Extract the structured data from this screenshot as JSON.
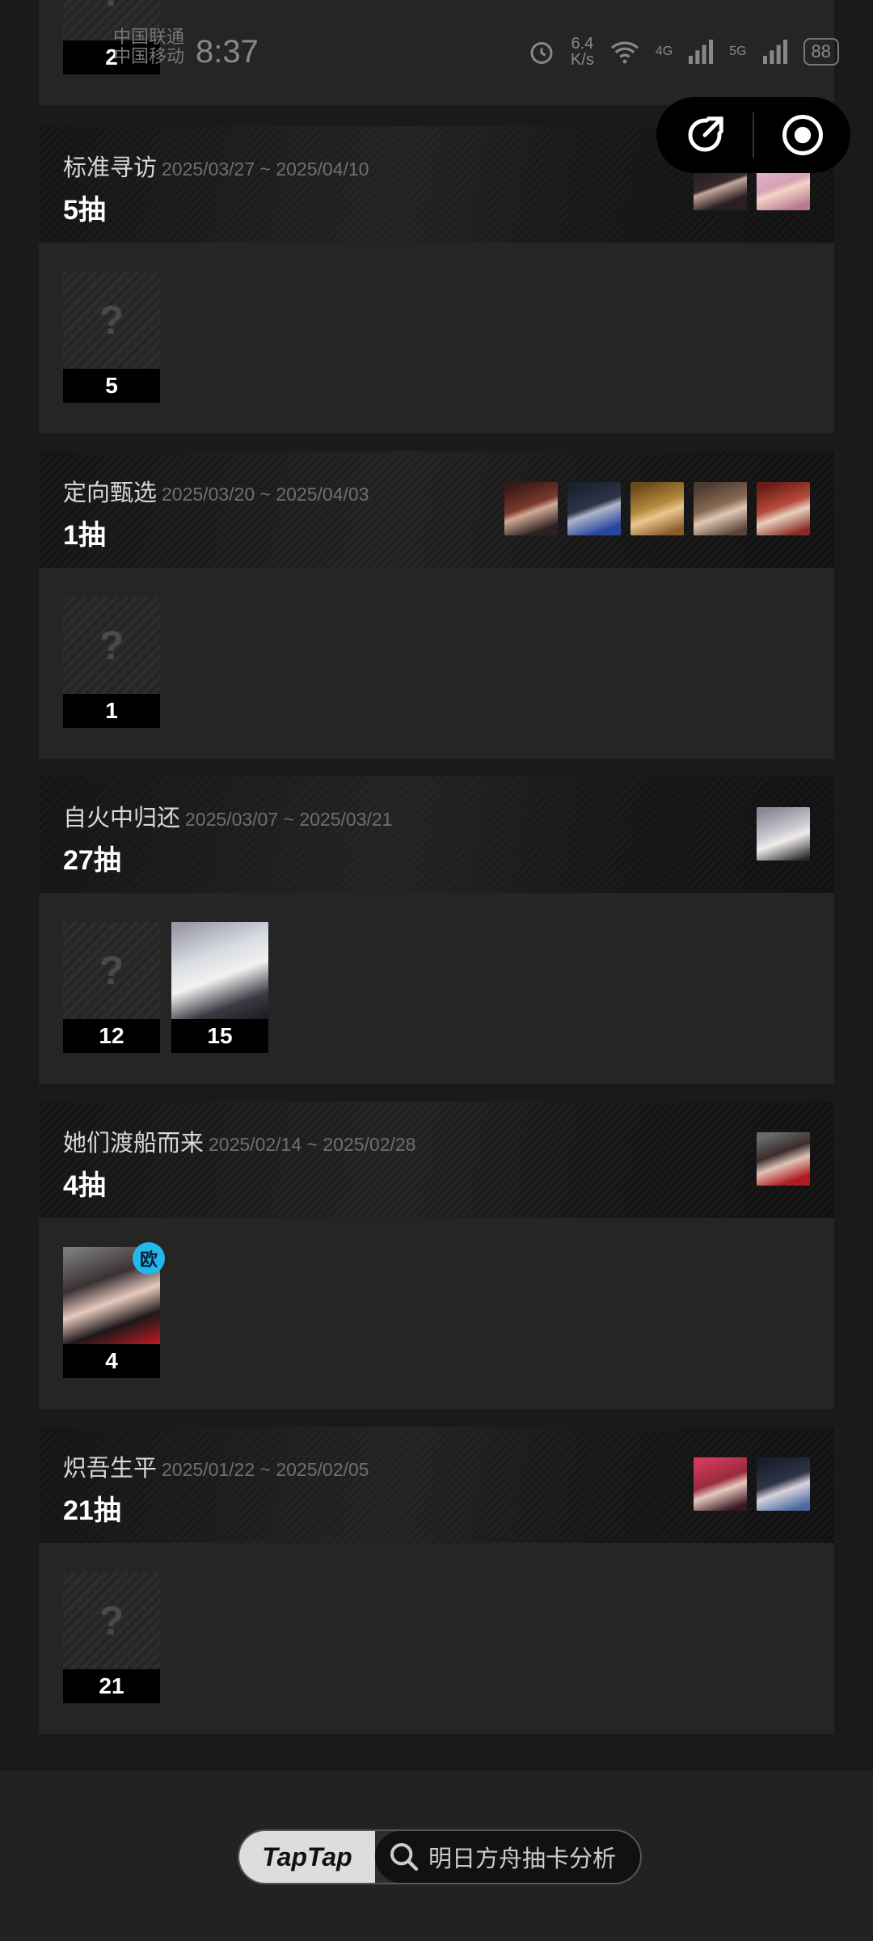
{
  "status_bar": {
    "carrier_1": "中国联通",
    "carrier_2": "中国移动",
    "time": "8:37",
    "net_speed_value": "6.4",
    "net_speed_unit": "K/s",
    "net_4g": "4G",
    "net_5g": "5G",
    "battery": "88"
  },
  "capsule": {
    "share_icon": "share-arrow-icon",
    "record_icon": "record-target-icon"
  },
  "top_card": {
    "count": "2"
  },
  "pools": [
    {
      "name": "标准寻访",
      "dates": "2025/03/27 ~ 2025/04/10",
      "pulls": "5抽",
      "avatars": [
        {
          "name": "black-haired-operator",
          "color": "#3a2a2e"
        },
        {
          "name": "pink-haired-operator",
          "color": "#d7a0b8"
        }
      ],
      "cards": [
        {
          "type": "unknown",
          "mark": "?",
          "count": "5"
        }
      ]
    },
    {
      "name": "定向甄选",
      "dates": "2025/03/20 ~ 2025/04/03",
      "pulls": "1抽",
      "avatars": [
        {
          "name": "red-haired-operator",
          "color": "#7a3a2e"
        },
        {
          "name": "dark-armored-operator",
          "color": "#2c3548"
        },
        {
          "name": "golden-haired-operator",
          "color": "#b48a3c"
        },
        {
          "name": "brown-haired-operator",
          "color": "#8a6a52"
        },
        {
          "name": "red-fox-operator",
          "color": "#b84a3c"
        }
      ],
      "cards": [
        {
          "type": "unknown",
          "mark": "?",
          "count": "1"
        }
      ]
    },
    {
      "name": "自火中归还",
      "dates": "2025/03/07 ~ 2025/03/21",
      "pulls": "27抽",
      "avatars": [
        {
          "name": "white-haired-operator",
          "color": "#c8c8d0"
        }
      ],
      "cards": [
        {
          "type": "unknown",
          "mark": "?",
          "count": "12"
        },
        {
          "type": "portrait",
          "count": "15",
          "color": "#d8dbe2"
        }
      ]
    },
    {
      "name": "她们渡船而来",
      "dates": "2025/02/14 ~ 2025/02/28",
      "pulls": "4抽",
      "avatars": [
        {
          "name": "dark-horned-operator",
          "color": "#3a2c2c"
        }
      ],
      "cards": [
        {
          "type": "portrait",
          "count": "4",
          "color": "#3b3133",
          "badge": "欧"
        }
      ]
    },
    {
      "name": "炽吾生平",
      "dates": "2025/01/22 ~ 2025/02/05",
      "pulls": "21抽",
      "avatars": [
        {
          "name": "crimson-operator",
          "color": "#9a2a3c"
        },
        {
          "name": "blue-black-operator",
          "color": "#2e3548"
        }
      ],
      "cards": [
        {
          "type": "unknown",
          "mark": "?",
          "count": "21"
        }
      ]
    }
  ],
  "footer": {
    "logo": "TapTap",
    "search_text": "明日方舟抽卡分析"
  },
  "colors": {
    "accent_badge": "#22b8e8",
    "background": "#1a1a1a",
    "panel": "#252525"
  }
}
